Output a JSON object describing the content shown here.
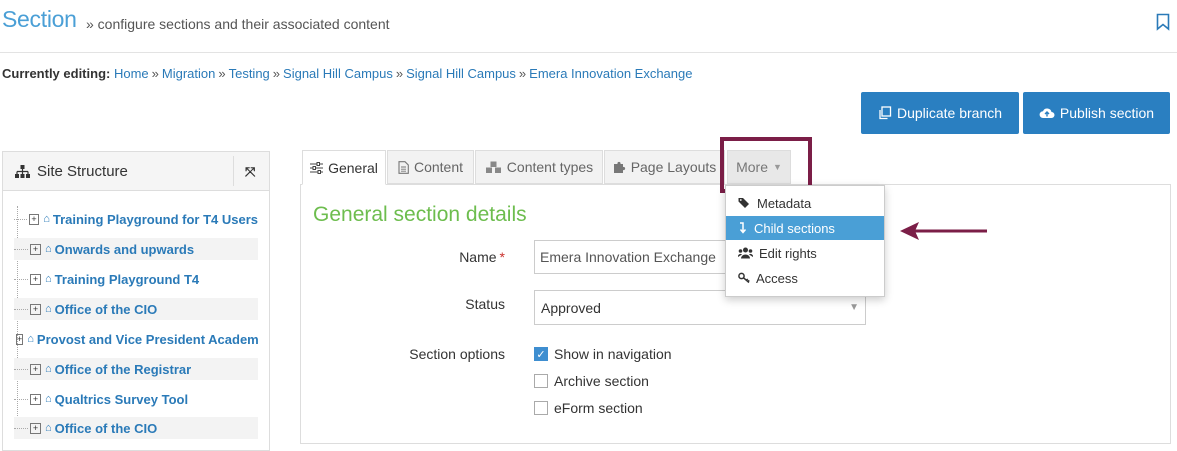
{
  "header": {
    "title": "Section",
    "subtitle": "» configure sections and their associated content"
  },
  "breadcrumb": {
    "prefix": "Currently editing:",
    "items": [
      "Home",
      "Migration",
      "Testing",
      "Signal Hill Campus",
      "Signal Hill Campus",
      "Emera Innovation Exchange"
    ],
    "separator": "»"
  },
  "actions": {
    "duplicate": "Duplicate branch",
    "publish": "Publish section"
  },
  "site_structure": {
    "title": "Site Structure",
    "items": [
      "Training Playground for T4 Users",
      "Onwards and upwards",
      "Training Playground T4",
      "Office of the CIO",
      "Provost and Vice President Academic",
      "Office of the Registrar",
      "Qualtrics Survey Tool",
      "Office of the CIO"
    ]
  },
  "tabs": {
    "general": "General",
    "content": "Content",
    "content_types": "Content types",
    "page_layouts": "Page Layouts",
    "more": "More"
  },
  "more_menu": {
    "metadata": "Metadata",
    "child_sections": "Child sections",
    "edit_rights": "Edit rights",
    "access": "Access"
  },
  "form": {
    "heading": "General section details",
    "name_label": "Name",
    "required_mark": "*",
    "name_value": "Emera Innovation Exchange",
    "status_label": "Status",
    "status_value": "Approved",
    "options_label": "Section options",
    "opt_nav": "Show in navigation",
    "opt_archive": "Archive section",
    "opt_eform": "eForm section"
  },
  "colors": {
    "accent": "#2a7fc1",
    "heading_green": "#6dbd4e",
    "highlight": "#7b1e47"
  }
}
